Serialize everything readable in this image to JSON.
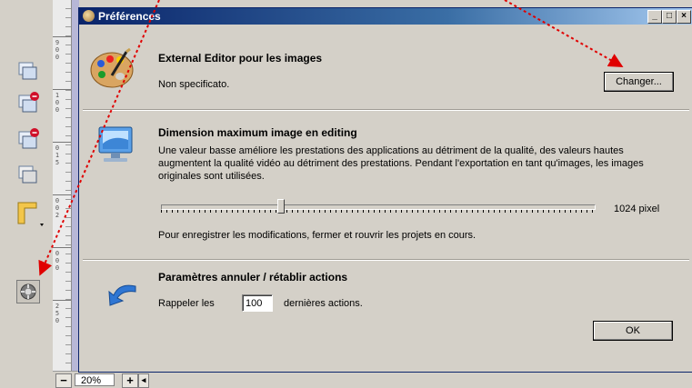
{
  "left_toolbar": {
    "tools": [
      {
        "icon": "layers-icon"
      },
      {
        "icon": "layers-remove-icon"
      },
      {
        "icon": "layers-delete-icon"
      },
      {
        "icon": "layers-copy-icon"
      },
      {
        "icon": "ruler-corner-icon"
      },
      {
        "icon": "preferences-icon"
      }
    ]
  },
  "ruler": {
    "labels": [
      "9",
      "0",
      "0",
      "1",
      "0",
      "0",
      "0",
      "1",
      "5",
      "0",
      "0",
      "2",
      "0",
      "0",
      "0",
      "2",
      "5",
      "0"
    ]
  },
  "bottom_bar": {
    "minus": "−",
    "zoom": "20%",
    "plus": "+"
  },
  "dialog": {
    "title": "Préférences",
    "external_editor": {
      "title": "External Editor pour les images",
      "value": "Non specificato.",
      "change_button": "Changer..."
    },
    "max_dimension": {
      "title": "Dimension maximum image en editing",
      "description": "Une valeur basse améliore les prestations des applications au détriment de la qualité, des valeurs hautes augmentent la qualité vidéo au détriment des prestations. Pendant l'exportation en tant qu'images, les images originales sont utilisées.",
      "slider_value_label": "1024 pixel",
      "slider_level": 0.27,
      "note": "Pour enregistrer les modifications, fermer et rouvrir les projets en cours."
    },
    "undo_redo": {
      "title": "Paramètres annuler / rétablir actions",
      "prefix": "Rappeler les",
      "count": "100",
      "suffix": "dernières actions."
    },
    "ok_button": "OK"
  },
  "colors": {
    "annotation_arrow": "#e00000",
    "titlebar": "#0a246a"
  }
}
